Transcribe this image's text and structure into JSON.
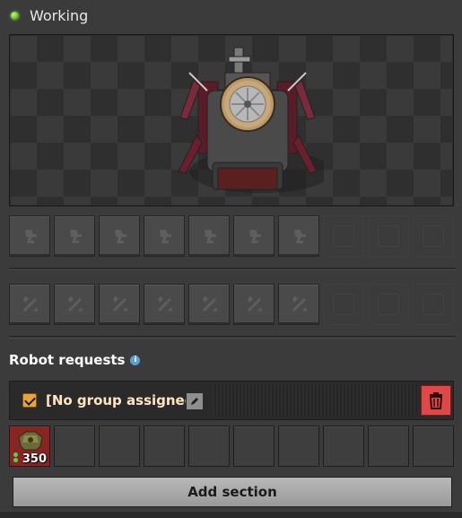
{
  "status": {
    "text": "Working",
    "indicator_color": "#5fb82a"
  },
  "preview": {
    "subject_icon": "machine-icon"
  },
  "upper_slots": {
    "filled_count": 7,
    "empty_count": 3,
    "icon": "robot-arm-icon"
  },
  "lower_slots": {
    "filled_count": 7,
    "empty_count": 3,
    "icon": "wrench-icon"
  },
  "robot_requests": {
    "title": "Robot requests",
    "info_icon": "i",
    "section": {
      "checked": true,
      "group_label": "[No group assigned]",
      "edit_icon": "pencil-icon",
      "delete_icon": "trash-icon",
      "delete_color": "#e04848",
      "requests": [
        {
          "icon": "armor-item-icon",
          "count": "350"
        }
      ],
      "empty_request_slots": 9
    },
    "add_section_label": "Add section"
  }
}
